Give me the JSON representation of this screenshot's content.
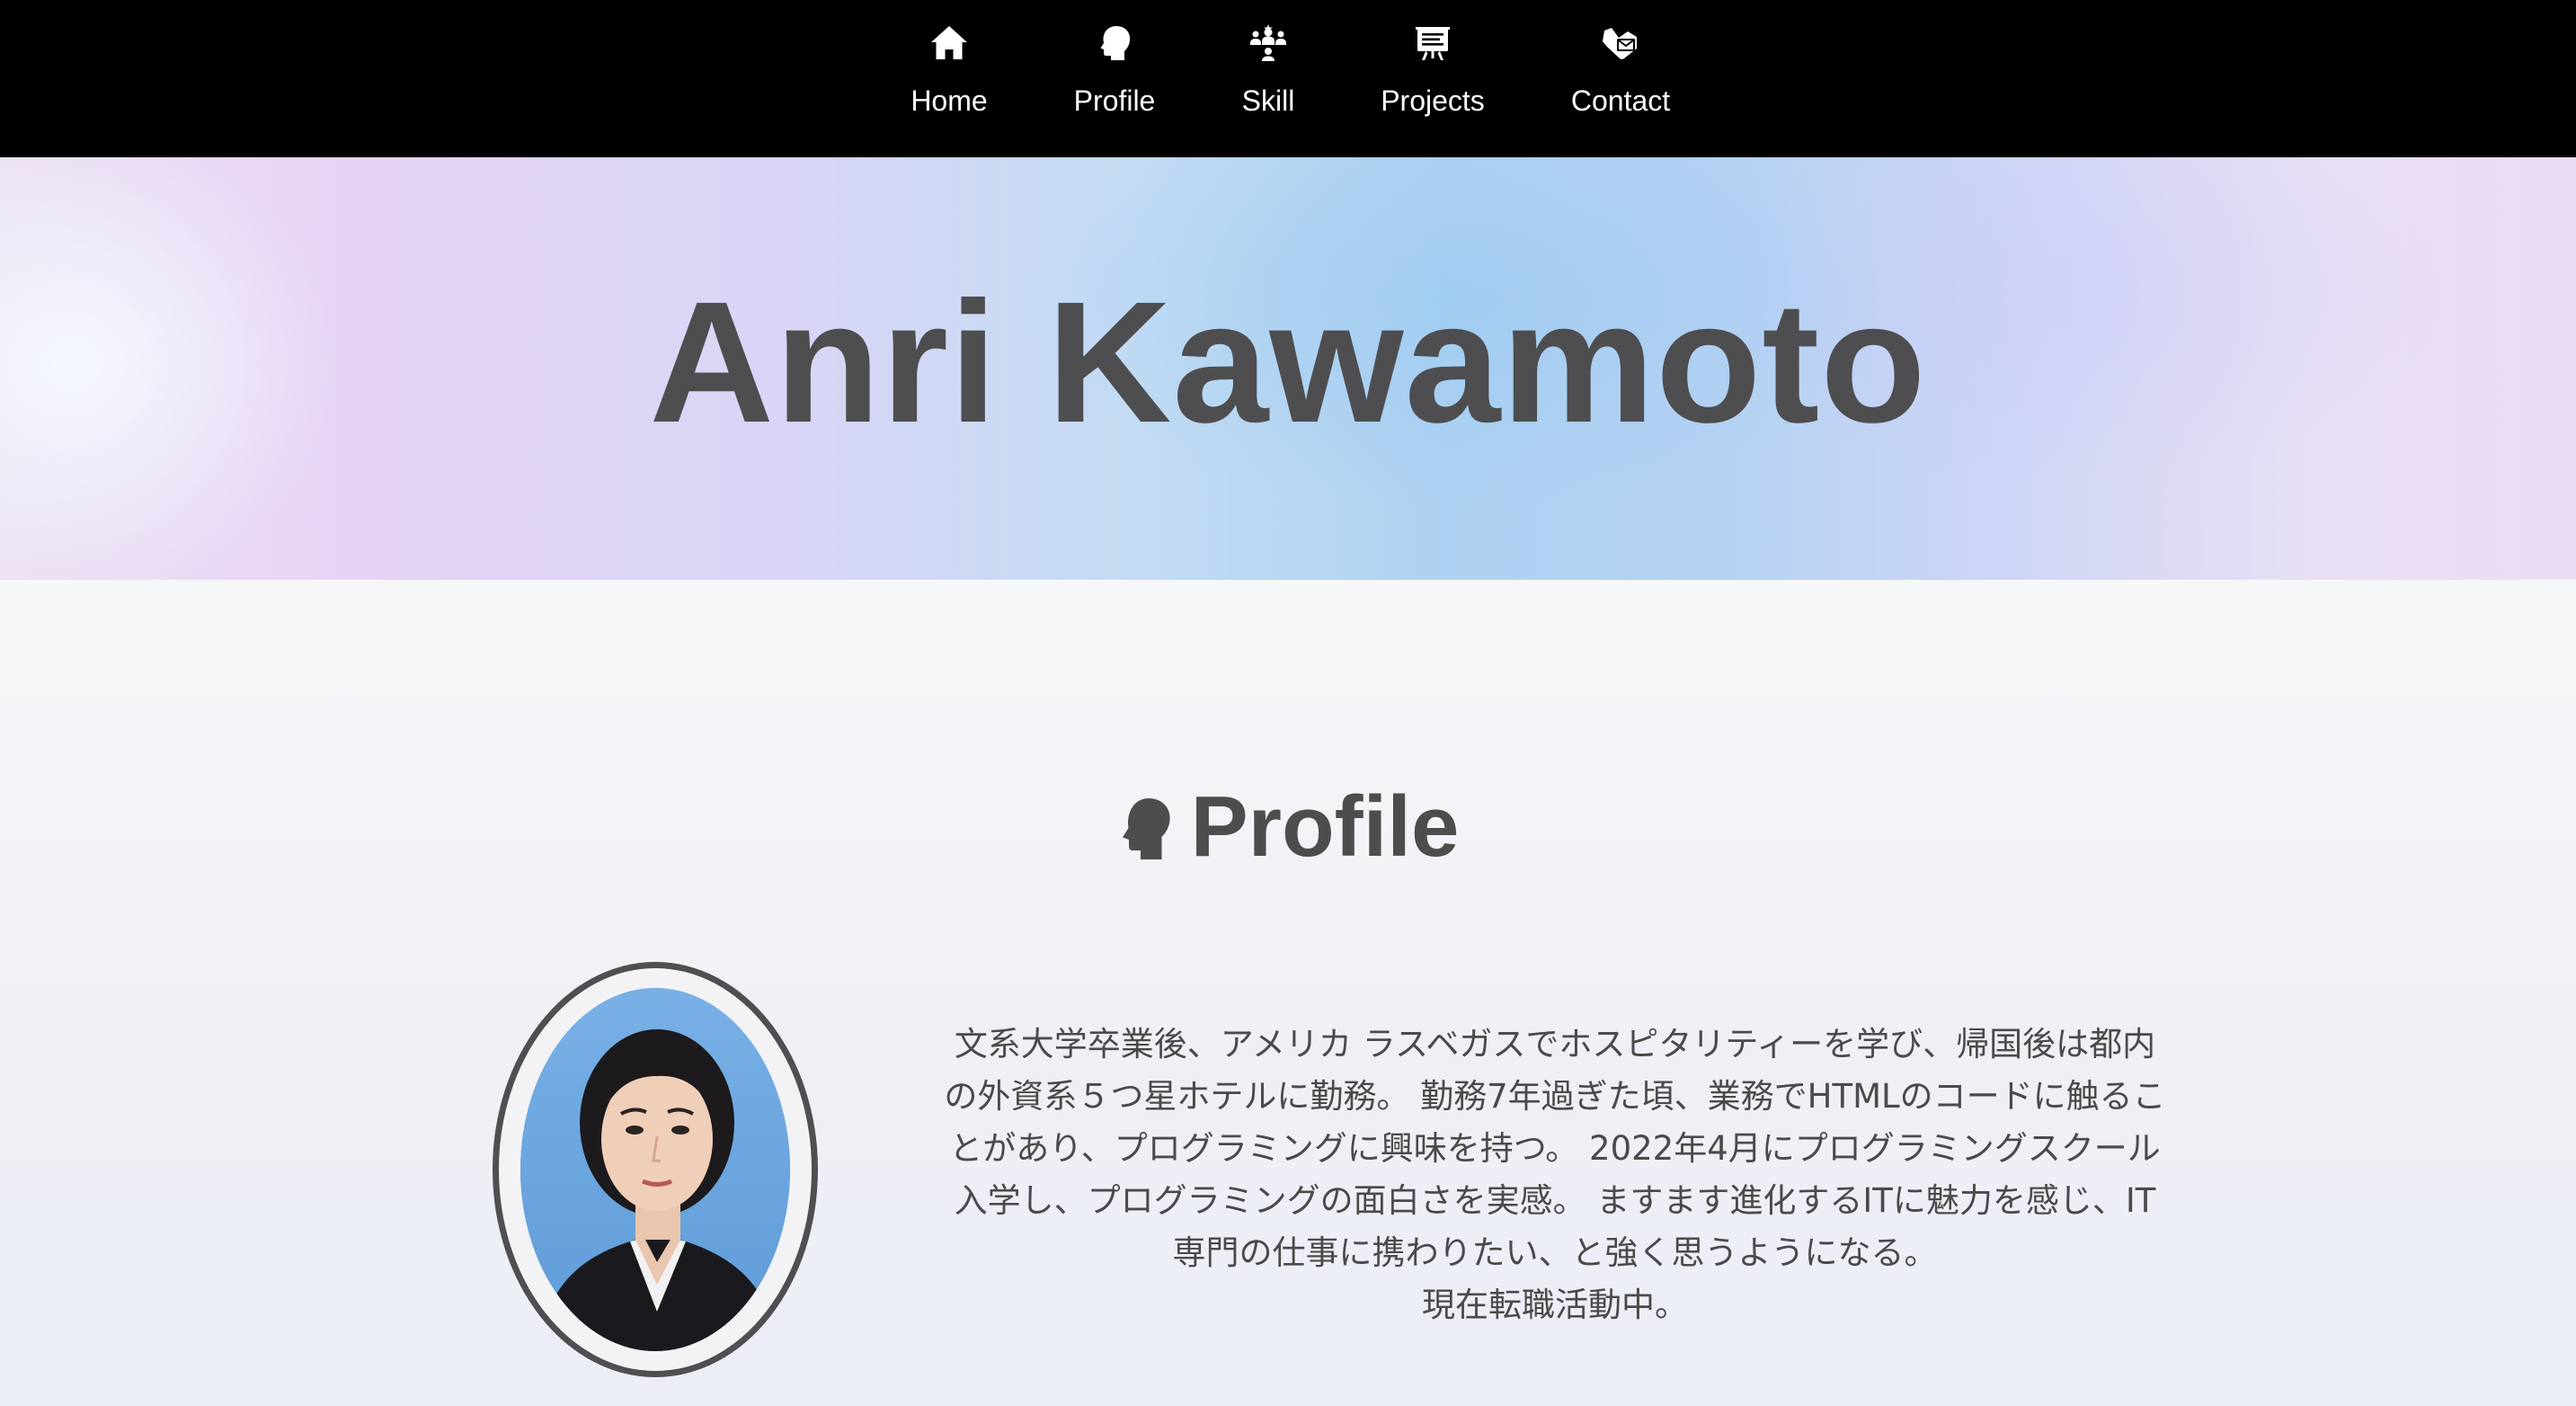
{
  "nav": {
    "items": [
      {
        "label": "Home",
        "icon": "home-icon"
      },
      {
        "label": "Profile",
        "icon": "head-icon"
      },
      {
        "label": "Skill",
        "icon": "skill-people-icon"
      },
      {
        "label": "Projects",
        "icon": "presentation-board-icon"
      },
      {
        "label": "Contact",
        "icon": "handshake-mail-icon"
      }
    ]
  },
  "hero": {
    "title": "Anri Kawamoto"
  },
  "profile": {
    "heading": "Profile",
    "heading_icon": "head-icon",
    "photo_alt": "profile-photo",
    "bio_lines": [
      "文系大学卒業後、アメリカ ラスベガスでホスピタリティーを学び、帰国後は都内",
      "の外資系５つ星ホテルに勤務。 勤務7年過ぎた頃、業務でHTMLのコードに触るこ",
      "とがあり、プログラミングに興味を持つ。 2022年4月にプログラミングスクール",
      "入学し、プログラミングの面白さを実感。 ますます進化するITに魅力を感じ、IT",
      "専門の仕事に携わりたい、と強く思うようになる。",
      "現在転職活動中。"
    ]
  },
  "colors": {
    "nav_bg": "#000000",
    "text": "#4d4d4d",
    "hero_pink": "#e6d4f6",
    "hero_blue": "#aed2f1"
  }
}
